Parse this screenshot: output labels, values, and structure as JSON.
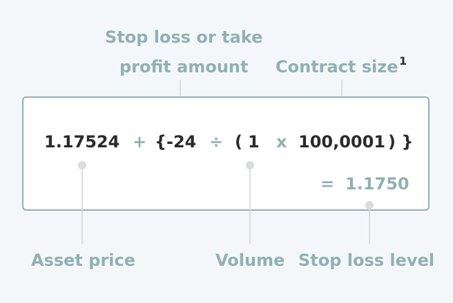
{
  "labels": {
    "sl_tp_line1": "Stop loss or take",
    "sl_tp_line2": "profit amount",
    "contract_size": "Contract size",
    "footnote_marker": "1",
    "asset_price": "Asset price",
    "volume": "Volume",
    "stop_loss_level": "Stop loss level"
  },
  "formula": {
    "asset_price": "1.17524",
    "plus": "+",
    "open_brace": "{",
    "amount": "-24",
    "divide": "÷",
    "open_paren": "(",
    "volume": "1",
    "times": "x",
    "contract_size": "100,0001",
    "close": ") }",
    "equals": "=",
    "result": "1.1750"
  },
  "colors": {
    "accent": "#8fb1b3",
    "text": "#2b2b2b",
    "connector": "#dadde0",
    "background": "#f4f7f9"
  }
}
